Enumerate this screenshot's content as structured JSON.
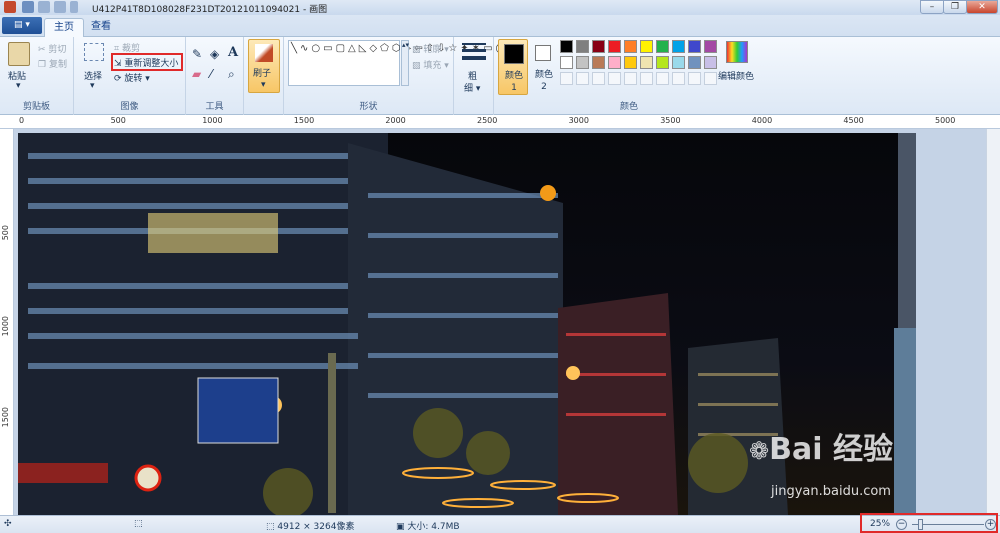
{
  "window": {
    "title": "U412P41T8D108028F231DT20121011094021 - 画图",
    "min": "–",
    "max": "❐",
    "close": "✕"
  },
  "tabs": {
    "file": "▤ ▾",
    "home": "主页",
    "view": "查看"
  },
  "clipboard": {
    "paste": "粘贴",
    "cut": "剪切",
    "copy": "复制",
    "label": "剪贴板"
  },
  "image": {
    "select": "选择",
    "crop": "裁剪",
    "resize": "重新调整大小",
    "rotate": "旋转",
    "label": "图像"
  },
  "tools": {
    "label": "工具"
  },
  "brushes": {
    "label": "刷子"
  },
  "shapes": {
    "outline": "轮廓",
    "fill": "填充",
    "label": "形状"
  },
  "size": {
    "label1": "粗",
    "label2": "细"
  },
  "colors": {
    "color1": "颜色 1",
    "color2": "颜色 2",
    "edit": "编辑颜色",
    "label": "颜色",
    "color1_value": "#000000",
    "color2_value": "#ffffff",
    "palette_row1": [
      "#000000",
      "#7f7f7f",
      "#880015",
      "#ed1c24",
      "#ff7f27",
      "#fff200",
      "#22b14c",
      "#00a2e8",
      "#3f48cc",
      "#a349a4"
    ],
    "palette_row2": [
      "#ffffff",
      "#c3c3c3",
      "#b97a57",
      "#ffaec9",
      "#ffc90e",
      "#efe4b0",
      "#b5e61d",
      "#99d9ea",
      "#7092be",
      "#c8bfe7"
    ]
  },
  "ruler_h": [
    "0",
    "500",
    "1000",
    "1500",
    "2000",
    "2500",
    "3000",
    "3500",
    "4000",
    "4500",
    "5000"
  ],
  "ruler_v": [
    "500",
    "1000",
    "1500"
  ],
  "status": {
    "dimensions": "4912 × 3264像素",
    "size": "大小: 4.7MB",
    "zoom": "25%"
  },
  "watermark": {
    "logo": "Bai 经验",
    "url": "jingyan.baidu.com"
  }
}
